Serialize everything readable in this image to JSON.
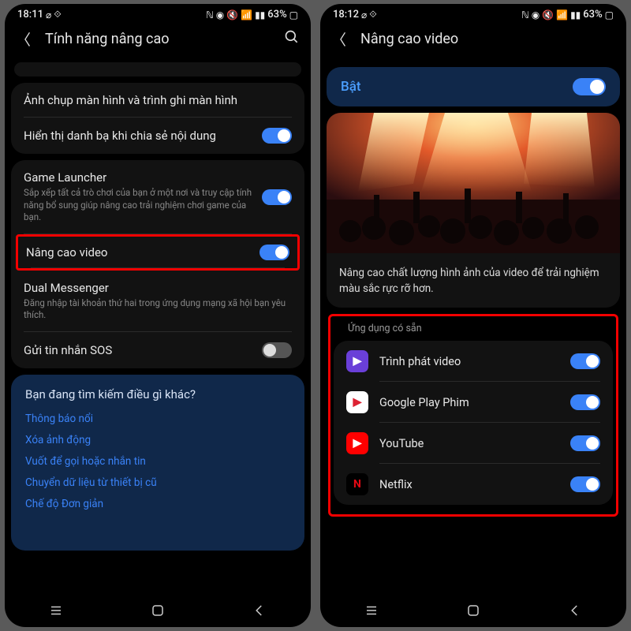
{
  "left": {
    "status": {
      "time": "18:11",
      "battery": "63%"
    },
    "title": "Tính năng nâng cao",
    "rows": {
      "screenshot": "Ảnh chụp màn hình và trình ghi màn hình",
      "share_contacts": "Hiển thị danh bạ khi chia sẻ nội dung",
      "game_launcher": "Game Launcher",
      "game_launcher_desc": "Sắp xếp tất cả trò chơi của bạn ở một nơi và truy cập tính năng bổ sung giúp nâng cao trải nghiệm chơi game của bạn.",
      "video_enhancer": "Nâng cao video",
      "dual_messenger": "Dual Messenger",
      "dual_messenger_desc": "Đăng nhập tài khoản thứ hai trong ứng dụng mạng xã hội bạn yêu thích.",
      "sos": "Gửi tin nhắn SOS"
    },
    "search_card": {
      "heading": "Bạn đang tìm kiếm điều gì khác?",
      "links": [
        "Thông báo nổi",
        "Xóa ảnh động",
        "Vuốt để gọi hoặc nhắn tin",
        "Chuyển dữ liệu từ thiết bị cũ",
        "Chế độ Đơn giản"
      ]
    }
  },
  "right": {
    "status": {
      "time": "18:12",
      "battery": "63%"
    },
    "title": "Nâng cao video",
    "on_label": "Bật",
    "hero_desc": "Nâng cao chất lượng hình ảnh của video để trải nghiệm màu sắc rực rỡ hơn.",
    "section": "Ứng dụng có sẵn",
    "apps": [
      {
        "name": "Trình phát video",
        "icon_bg": "#6a3fd8",
        "icon_fg": "#fff",
        "glyph": "▶"
      },
      {
        "name": "Google Play Phim",
        "icon_bg": "#fff",
        "icon_fg": "#d23",
        "glyph": "▶"
      },
      {
        "name": "YouTube",
        "icon_bg": "#f00",
        "icon_fg": "#fff",
        "glyph": "▶"
      },
      {
        "name": "Netflix",
        "icon_bg": "#000",
        "icon_fg": "#e50914",
        "glyph": "N"
      }
    ]
  }
}
